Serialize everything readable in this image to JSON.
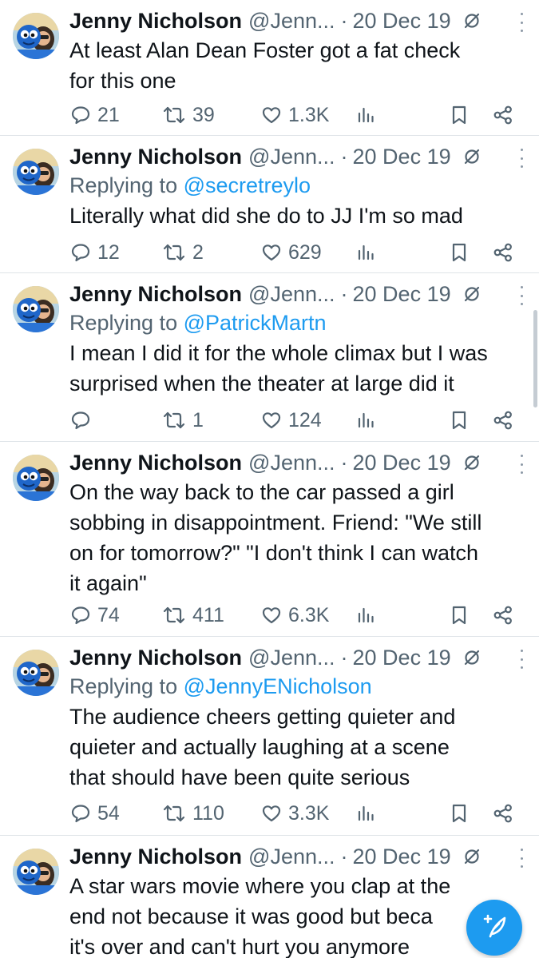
{
  "tweets": [
    {
      "name": "Jenny Nicholson",
      "handle": "@Jenn...",
      "sep": "·",
      "date": "20 Dec 19",
      "reply_prefix": "",
      "reply_to": "",
      "lines": [
        "At least Alan Dean Foster got a fat check",
        "for this one"
      ],
      "replies": "21",
      "retweets": "39",
      "likes": "1.3K"
    },
    {
      "name": "Jenny Nicholson",
      "handle": "@Jenn...",
      "sep": "·",
      "date": "20 Dec 19",
      "reply_prefix": "Replying to",
      "reply_to": "@secretreylo",
      "lines": [
        "Literally what did she do to JJ I'm so mad"
      ],
      "replies": "12",
      "retweets": "2",
      "likes": "629"
    },
    {
      "name": "Jenny Nicholson",
      "handle": "@Jenn...",
      "sep": "·",
      "date": "20 Dec 19",
      "reply_prefix": "Replying to",
      "reply_to": "@PatrickMartn",
      "lines": [
        "I mean I did it for the whole climax but I was",
        "surprised when the theater at large did it"
      ],
      "replies": "",
      "retweets": "1",
      "likes": "124"
    },
    {
      "name": "Jenny Nicholson",
      "handle": "@Jenn...",
      "sep": "·",
      "date": "20 Dec 19",
      "reply_prefix": "",
      "reply_to": "",
      "lines": [
        "On the way back to the car passed a girl",
        "sobbing in disappointment. Friend: \"We still",
        "on for tomorrow?\" \"I don't think I can watch",
        "it again\""
      ],
      "replies": "74",
      "retweets": "411",
      "likes": "6.3K"
    },
    {
      "name": "Jenny Nicholson",
      "handle": "@Jenn...",
      "sep": "·",
      "date": "20 Dec 19",
      "reply_prefix": "Replying to",
      "reply_to": "@JennyENicholson",
      "lines": [
        "The audience cheers getting quieter and",
        "quieter and actually laughing at a scene",
        "that should have been quite serious"
      ],
      "replies": "54",
      "retweets": "110",
      "likes": "3.3K"
    },
    {
      "name": "Jenny Nicholson",
      "handle": "@Jenn...",
      "sep": "·",
      "date": "20 Dec 19",
      "reply_prefix": "",
      "reply_to": "",
      "lines": [
        "A star wars movie where you clap at the",
        "end not because it was good but beca",
        "it's over and can't hurt you anymore"
      ],
      "replies": "",
      "retweets": "",
      "likes": ""
    }
  ],
  "icons": {
    "reply": "reply-icon",
    "retweet": "retweet-icon",
    "like": "heart-icon",
    "views": "views-icon",
    "bookmark": "bookmark-icon",
    "share": "share-icon",
    "nsfw": "hidden-icon",
    "more": "more-icon",
    "compose": "compose-icon"
  },
  "colors": {
    "accent": "#1d9bf0",
    "text": "#0f1419",
    "secondary": "#536471",
    "divider": "#dfe4e8"
  }
}
